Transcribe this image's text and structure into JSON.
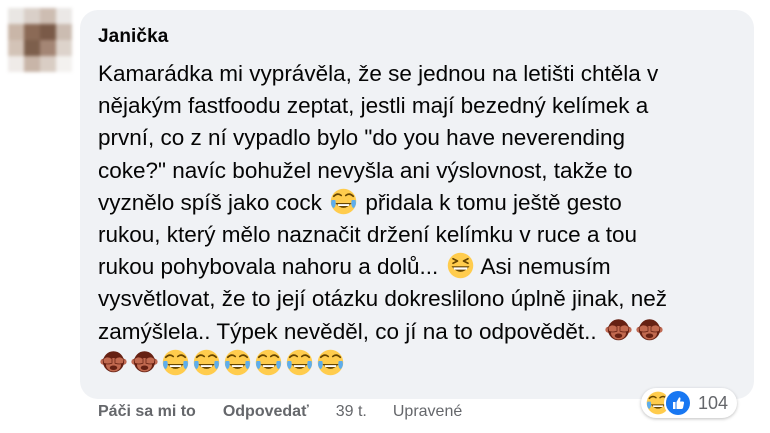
{
  "comment": {
    "author": "Janička",
    "lines": [
      "Kamarádka mi vyprávěla, že se jednou na letišti chtěla v",
      "nějakým fastfoodu zeptat, jestli mají bezedný kelímek a",
      "první, co z ní vypadlo bylo \"do you have neverending",
      "coke?\" navíc bohužel nevyšla ani výslovnost, takže to"
    ],
    "line5_before": "vyznělo spíš jako cock",
    "line5_after": "přidala k tomu ještě gesto",
    "line6": "rukou, který mělo naznačit držení kelímku v ruce a tou",
    "line7_before": "rukou pohybovala nahoru a dolů...",
    "line7_after": "Asi nemusím",
    "line8": "vysvětlovat, že to její otázku dokreslilono úplně jinak, než",
    "line9": "zamýšlela.. Týpek nevěděl, co jí na to odpovědět..",
    "emoji_names": {
      "laugh": "face-with-tears-of-joy-icon",
      "grin": "grinning-squinting-face-icon",
      "monkey": "see-no-evil-monkey-icon"
    }
  },
  "reactions": {
    "count": "104",
    "icons": [
      "haha-reaction-icon",
      "like-reaction-icon"
    ],
    "like_color": "#1877f2"
  },
  "actions": {
    "like": "Páči sa mi to",
    "reply": "Odpovedať",
    "time": "39 t.",
    "edited": "Upravené"
  },
  "colors": {
    "bubble": "#f0f2f5",
    "text": "#050505",
    "secondary": "#65676b"
  }
}
